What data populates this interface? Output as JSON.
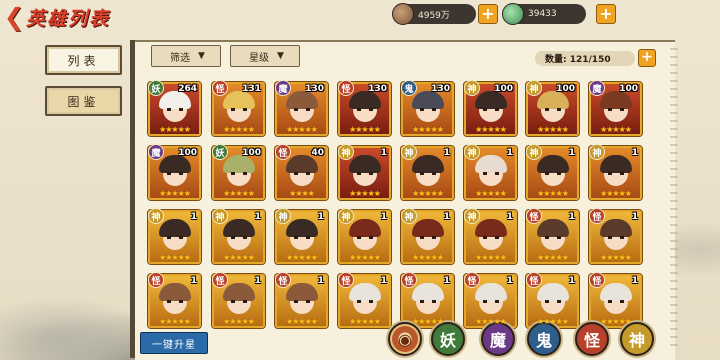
{
  "header": {
    "title": "英雄列表",
    "coin_value": "4959万",
    "jade_value": "39433",
    "plus_label": "+"
  },
  "sidebar": {
    "tabs": [
      {
        "label": "列表"
      },
      {
        "label": "图鉴"
      }
    ]
  },
  "toolbar": {
    "filter_label": "筛选",
    "star_label": "星级",
    "count_text": "数量: 121/150"
  },
  "heroes": [
    {
      "type": "妖",
      "level": "264",
      "stars": "★★★★★",
      "bg": "bg-red",
      "hair": "#f3f0ec"
    },
    {
      "type": "怪",
      "level": "131",
      "stars": "★★★★★",
      "bg": "bg-orange",
      "hair": "#e7c25a"
    },
    {
      "type": "魔",
      "level": "130",
      "stars": "★★★★★",
      "bg": "bg-orange",
      "hair": "#8a5a3a"
    },
    {
      "type": "怪",
      "level": "130",
      "stars": "★★★★★",
      "bg": "bg-red",
      "hair": "#3a2a24"
    },
    {
      "type": "鬼",
      "level": "130",
      "stars": "★★★★★",
      "bg": "bg-orange",
      "hair": "#4a4a58"
    },
    {
      "type": "神",
      "level": "100",
      "stars": "★★★★★",
      "bg": "bg-red",
      "hair": "#3a2a24"
    },
    {
      "type": "神",
      "level": "100",
      "stars": "★★★★★",
      "bg": "bg-red",
      "hair": "#d8b05a"
    },
    {
      "type": "魔",
      "level": "100",
      "stars": "★★★★★",
      "bg": "bg-red",
      "hair": "#7a3a22"
    },
    {
      "type": "魔",
      "level": "100",
      "stars": "★★★★★",
      "bg": "bg-orange",
      "hair": "#3a2a24"
    },
    {
      "type": "妖",
      "level": "100",
      "stars": "★★★★★",
      "bg": "bg-orange",
      "hair": "#a8b06a"
    },
    {
      "type": "怪",
      "level": "40",
      "stars": "★★★★",
      "bg": "bg-orange",
      "hair": "#5a3a2a"
    },
    {
      "type": "神",
      "level": "1",
      "stars": "★★★★★",
      "bg": "bg-red",
      "hair": "#3a2a24"
    },
    {
      "type": "神",
      "level": "1",
      "stars": "★★★★★",
      "bg": "bg-orange",
      "hair": "#3a2a24"
    },
    {
      "type": "神",
      "level": "1",
      "stars": "★★★★★",
      "bg": "bg-orange",
      "hair": "#e8dcd0"
    },
    {
      "type": "神",
      "level": "1",
      "stars": "★★★★★",
      "bg": "bg-orange",
      "hair": "#3a2a24"
    },
    {
      "type": "神",
      "level": "1",
      "stars": "★★★★★",
      "bg": "bg-orange",
      "hair": "#3a2a24"
    },
    {
      "type": "神",
      "level": "1",
      "stars": "★★★★★",
      "bg": "bg-gold",
      "hair": "#3a2a24"
    },
    {
      "type": "神",
      "level": "1",
      "stars": "★★★★★",
      "bg": "bg-gold",
      "hair": "#3a2a24"
    },
    {
      "type": "神",
      "level": "1",
      "stars": "★★★★★",
      "bg": "bg-gold",
      "hair": "#3a2a24"
    },
    {
      "type": "神",
      "level": "1",
      "stars": "★★★★★",
      "bg": "bg-gold",
      "hair": "#7a2a1a"
    },
    {
      "type": "神",
      "level": "1",
      "stars": "★★★★★",
      "bg": "bg-gold",
      "hair": "#7a2a1a"
    },
    {
      "type": "神",
      "level": "1",
      "stars": "★★★★★",
      "bg": "bg-gold",
      "hair": "#7a2a1a"
    },
    {
      "type": "怪",
      "level": "1",
      "stars": "★★★★★",
      "bg": "bg-gold",
      "hair": "#5a3a2a"
    },
    {
      "type": "怪",
      "level": "1",
      "stars": "★★★★★",
      "bg": "bg-gold",
      "hair": "#5a3a2a"
    },
    {
      "type": "怪",
      "level": "1",
      "stars": "★★★★★",
      "bg": "bg-gold",
      "hair": "#8a5a3a"
    },
    {
      "type": "怪",
      "level": "1",
      "stars": "★★★★★",
      "bg": "bg-gold",
      "hair": "#8a5a3a"
    },
    {
      "type": "怪",
      "level": "1",
      "stars": "★★★★★",
      "bg": "bg-gold",
      "hair": "#8a5a3a"
    },
    {
      "type": "怪",
      "level": "1",
      "stars": "★★★★★",
      "bg": "bg-gold",
      "hair": "#e8e4dc"
    },
    {
      "type": "怪",
      "level": "1",
      "stars": "★★★★★",
      "bg": "bg-gold",
      "hair": "#e8e4dc"
    },
    {
      "type": "怪",
      "level": "1",
      "stars": "★★★★★",
      "bg": "bg-gold",
      "hair": "#e8e4dc"
    },
    {
      "type": "怪",
      "level": "1",
      "stars": "★★★★★",
      "bg": "bg-gold",
      "hair": "#e8e4dc"
    },
    {
      "type": "怪",
      "level": "1",
      "stars": "★★★★★",
      "bg": "bg-gold",
      "hair": "#e8e4dc"
    }
  ],
  "bottom": {
    "upstar_label": "一键升星",
    "categories": [
      {
        "label": "",
        "icon": "all-category-icon"
      },
      {
        "label": "妖"
      },
      {
        "label": "魔"
      },
      {
        "label": "鬼"
      },
      {
        "label": "怪"
      },
      {
        "label": "神"
      }
    ]
  },
  "type_colors": {
    "妖": "#3f7a3a",
    "魔": "#6a3a86",
    "鬼": "#2e5e8a",
    "怪": "#b8402a",
    "神": "#c49a2a"
  }
}
